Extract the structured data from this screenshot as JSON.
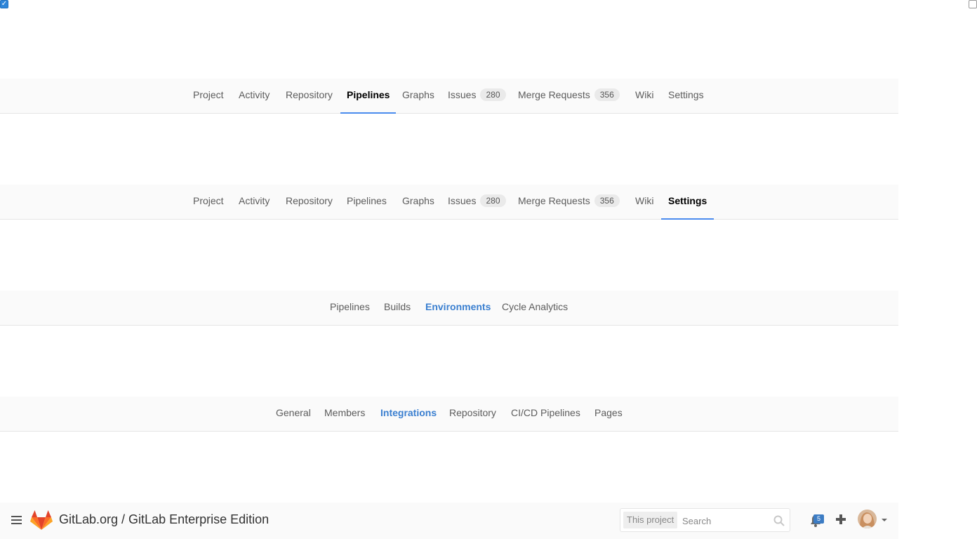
{
  "checkboxes": {
    "left_checked": true,
    "right_checked": false
  },
  "nav1": {
    "items": [
      {
        "label": "Project"
      },
      {
        "label": "Activity"
      },
      {
        "label": "Repository"
      },
      {
        "label": "Pipelines",
        "active": true
      },
      {
        "label": "Graphs"
      },
      {
        "label": "Issues",
        "count": "280"
      },
      {
        "label": "Merge Requests",
        "count": "356"
      },
      {
        "label": "Wiki"
      },
      {
        "label": "Settings"
      }
    ]
  },
  "nav2": {
    "items": [
      {
        "label": "Project"
      },
      {
        "label": "Activity"
      },
      {
        "label": "Repository"
      },
      {
        "label": "Pipelines"
      },
      {
        "label": "Graphs"
      },
      {
        "label": "Issues",
        "count": "280"
      },
      {
        "label": "Merge Requests",
        "count": "356"
      },
      {
        "label": "Wiki"
      },
      {
        "label": "Settings",
        "active": true
      }
    ]
  },
  "subnav_pipelines": {
    "items": [
      {
        "label": "Pipelines"
      },
      {
        "label": "Builds"
      },
      {
        "label": "Environments",
        "active": true
      },
      {
        "label": "Cycle Analytics"
      }
    ]
  },
  "subnav_settings": {
    "items": [
      {
        "label": "General"
      },
      {
        "label": "Members"
      },
      {
        "label": "Integrations",
        "active": true
      },
      {
        "label": "Repository"
      },
      {
        "label": "CI/CD Pipelines"
      },
      {
        "label": "Pages"
      }
    ]
  },
  "header": {
    "title": "GitLab.org / GitLab Enterprise Edition",
    "search_scope": "This project",
    "search_placeholder": "Search",
    "notification_count": "5"
  },
  "colors": {
    "accent": "#4a8bee",
    "link_active": "#3a7fd0",
    "logo_orange": "#e24329"
  }
}
